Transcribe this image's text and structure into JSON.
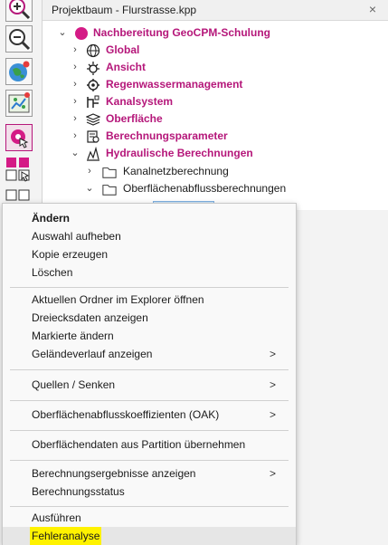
{
  "panel": {
    "title": "Projektbaum - Flurstrasse.kpp",
    "close_symbol": "×"
  },
  "tree": {
    "root": "Nachbereitung GeoCPM-Schulung",
    "items": [
      {
        "label": "Global",
        "icon": "globe-icon"
      },
      {
        "label": "Ansicht",
        "icon": "view-gear-icon"
      },
      {
        "label": "Regenwassermanagement",
        "icon": "rain-gear-icon"
      },
      {
        "label": "Kanalsystem",
        "icon": "pipe-network-icon"
      },
      {
        "label": "Oberfläche",
        "icon": "layers-icon"
      },
      {
        "label": "Berechnungsparameter",
        "icon": "settings-sheet-icon"
      },
      {
        "label": "Hydraulische Berechnungen",
        "icon": "hydraulic-chart-icon"
      }
    ],
    "folders": [
      {
        "label": "Kanalnetzberechnung"
      },
      {
        "label": "Oberflächenabflussberechnungen"
      }
    ]
  },
  "menu": {
    "groups": [
      [
        {
          "label": "Ändern",
          "bold": true
        },
        {
          "label": "Auswahl aufheben"
        },
        {
          "label": "Kopie erzeugen"
        },
        {
          "label": "Löschen"
        }
      ],
      [
        {
          "label": "Aktuellen Ordner im Explorer öffnen"
        },
        {
          "label": "Dreiecksdaten anzeigen"
        },
        {
          "label": "Markierte ändern"
        },
        {
          "label": "Geländeverlauf anzeigen",
          "submenu": true
        }
      ],
      [
        {
          "label": "Quellen / Senken",
          "submenu": true
        }
      ],
      [
        {
          "label": "Oberflächenabflusskoeffizienten (OAK)",
          "submenu": true
        }
      ],
      [
        {
          "label": "Oberflächendaten aus Partition übernehmen"
        }
      ],
      [
        {
          "label": "Berechnungsergebnisse anzeigen",
          "submenu": true
        },
        {
          "label": "Berechnungsstatus"
        }
      ],
      [
        {
          "label": "Ausführen"
        },
        {
          "label": "Fehleranalyse",
          "highlight": true
        }
      ]
    ],
    "submenu_arrow": ">"
  },
  "colors": {
    "accent": "#b5177a",
    "highlight": "#fff200"
  }
}
